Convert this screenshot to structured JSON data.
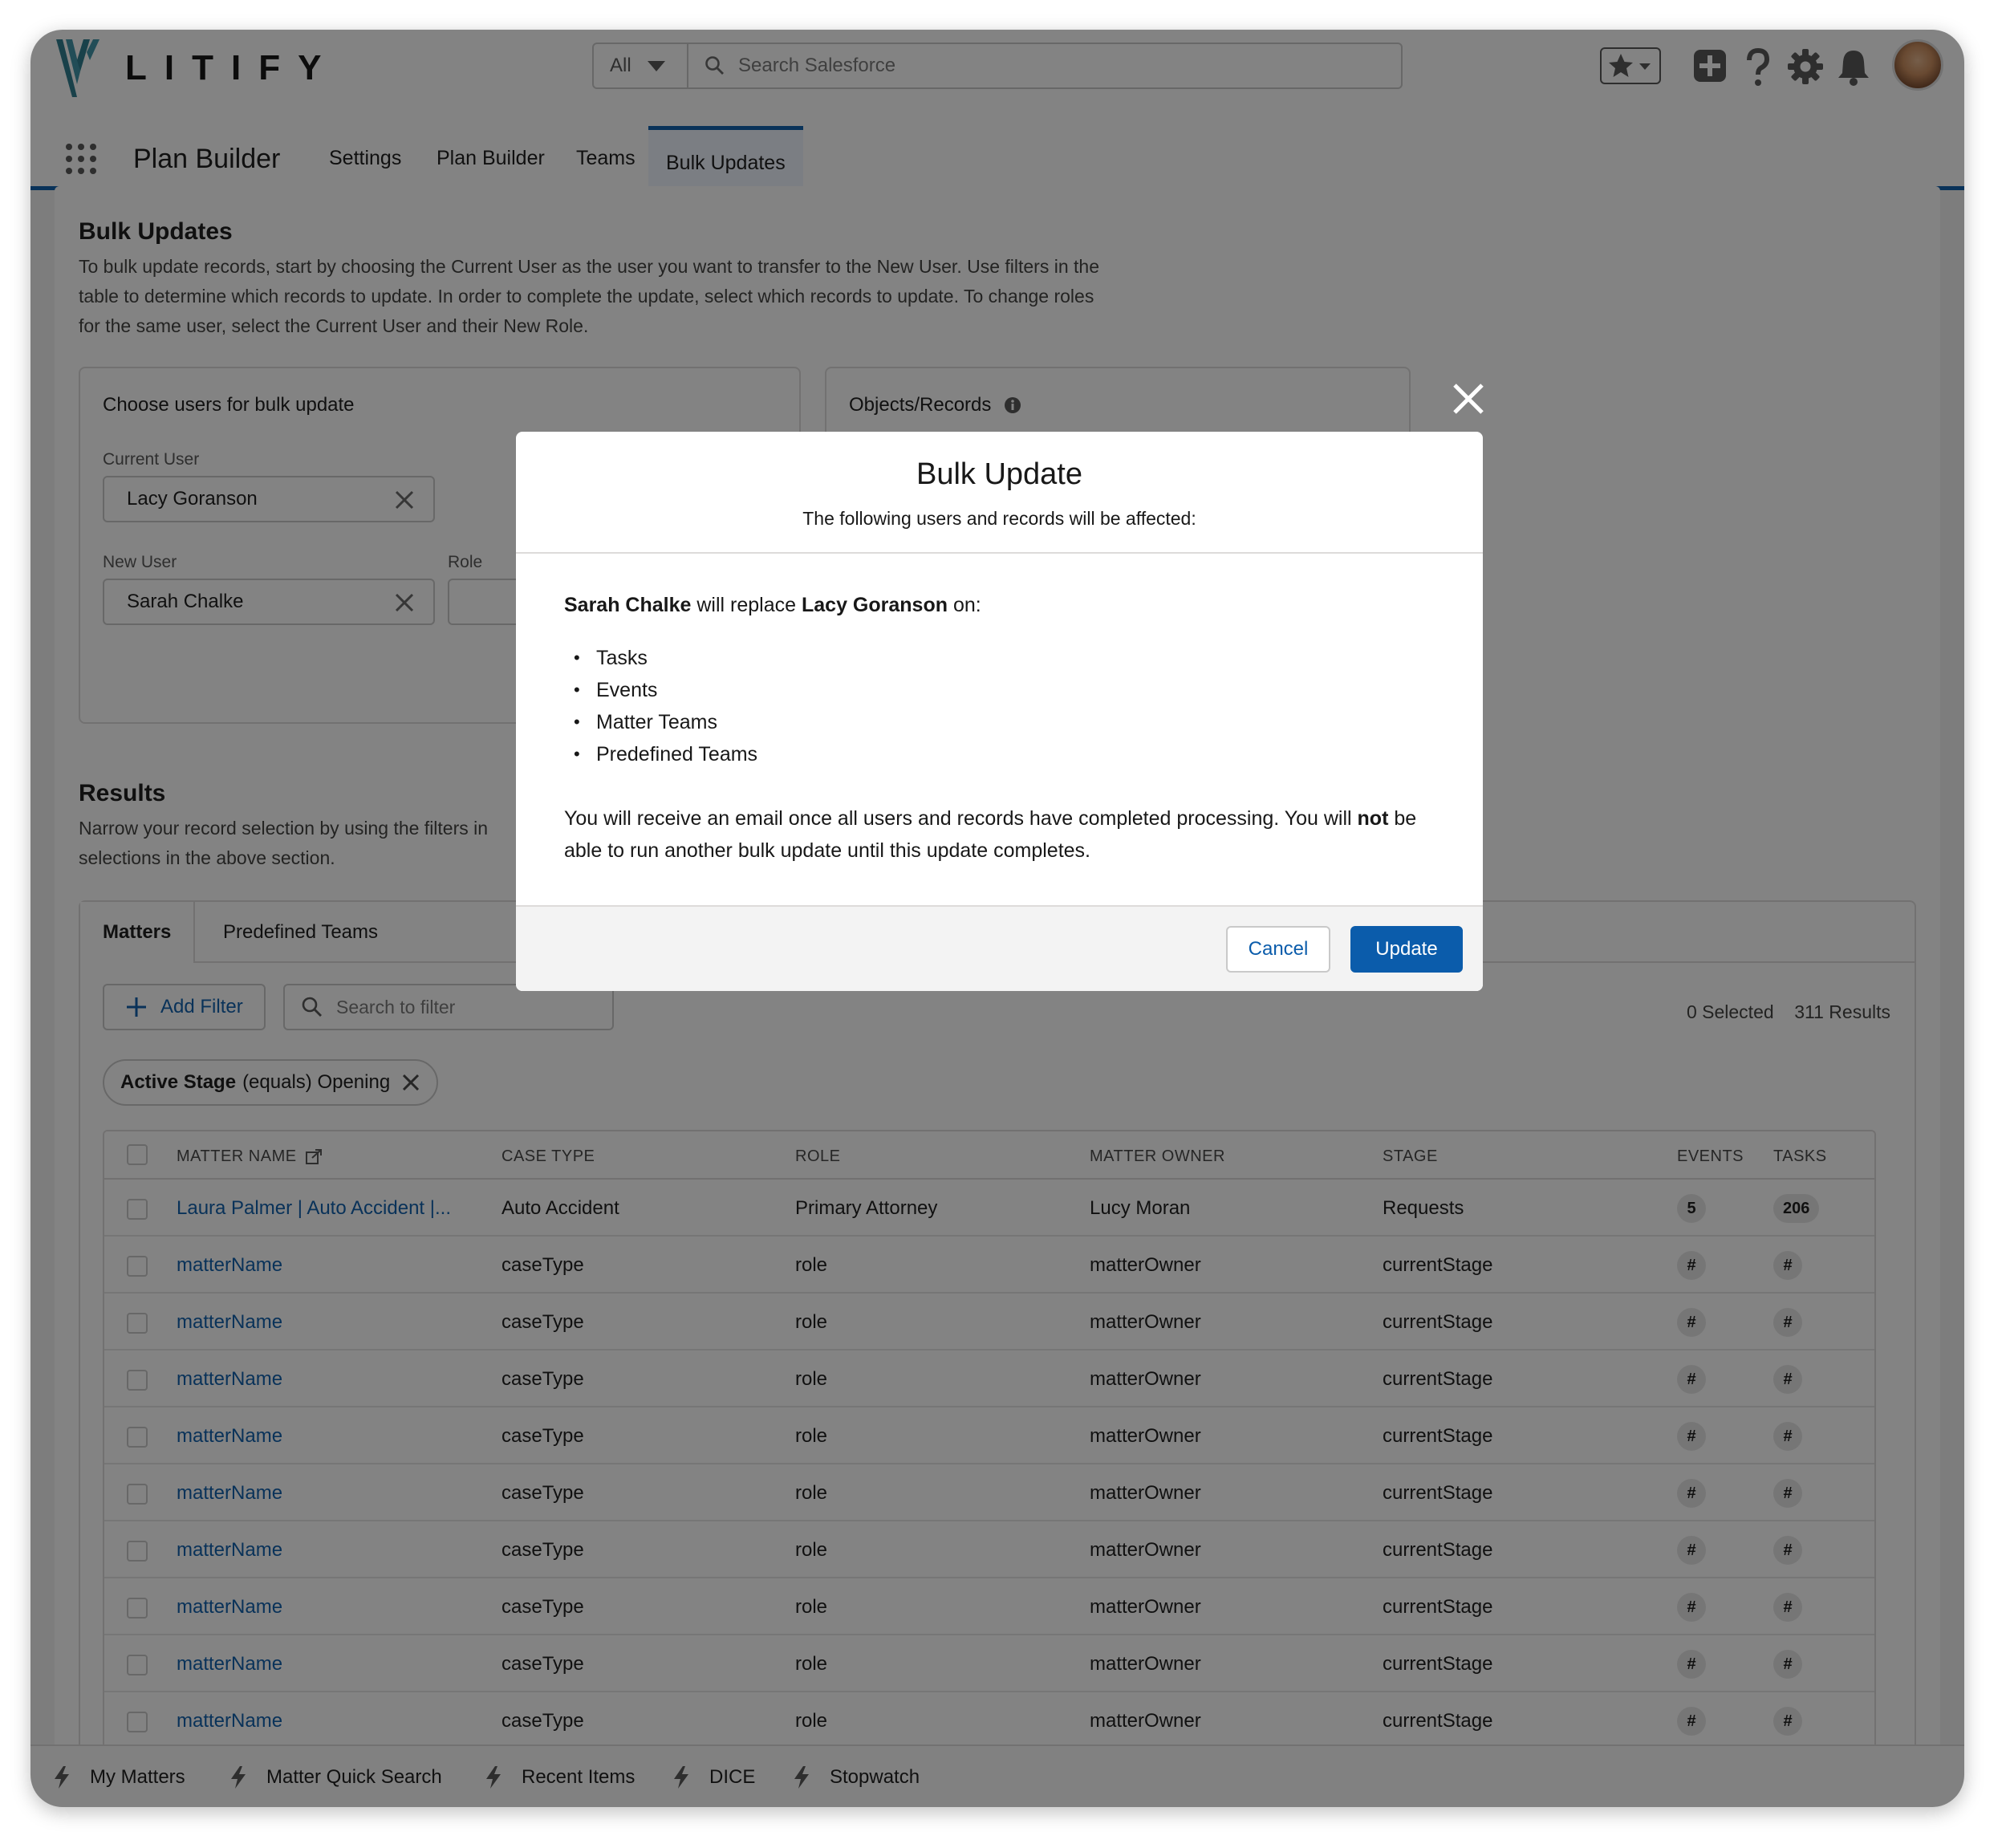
{
  "header": {
    "logo_text": "LITIFY",
    "search_scope": "All",
    "search_placeholder": "Search Salesforce"
  },
  "nav": {
    "app_name": "Plan Builder",
    "tabs": [
      {
        "label": "Settings"
      },
      {
        "label": "Plan Builder"
      },
      {
        "label": "Teams"
      },
      {
        "label": "Bulk Updates"
      }
    ]
  },
  "bulk_updates": {
    "title": "Bulk Updates",
    "description": "To bulk update records, start by choosing the Current User as the user you want to transfer to the New User. Use filters in the table to determine which records to update. In order to complete the update, select which records to update. To change roles for the same user, select the Current User and their New Role."
  },
  "choose_users": {
    "title": "Choose users for bulk update",
    "current_user_label": "Current User",
    "current_user_value": "Lacy Goranson",
    "new_user_label": "New User",
    "new_user_value": "Sarah Chalke",
    "role_label": "Role"
  },
  "objects_panel": {
    "title": "Objects/Records"
  },
  "results": {
    "title": "Results",
    "description_visible_1": "Narrow your record selection by using the filters in",
    "description_visible_2": "selections in the above section.",
    "tabs": [
      {
        "label": "Matters"
      },
      {
        "label": "Predefined Teams"
      }
    ],
    "add_filter_label": "Add Filter",
    "search_placeholder": "Search to filter",
    "selected_count": "0 Selected",
    "results_count": "311 Results",
    "filter_chip": {
      "field": "Active Stage",
      "operator_value": "(equals) Opening"
    }
  },
  "table": {
    "columns": [
      "MATTER NAME",
      "CASE TYPE",
      "ROLE",
      "MATTER OWNER",
      "STAGE",
      "EVENTS",
      "TASKS"
    ],
    "rows": [
      {
        "matter": "Laura Palmer | Auto Accident |...",
        "case_type": "Auto Accident",
        "role": "Primary Attorney",
        "owner": "Lucy Moran",
        "stage": "Requests",
        "events": "5",
        "tasks": "206"
      },
      {
        "matter": "matterName",
        "case_type": "caseType",
        "role": "role",
        "owner": "matterOwner",
        "stage": "currentStage",
        "events": "#",
        "tasks": "#"
      },
      {
        "matter": "matterName",
        "case_type": "caseType",
        "role": "role",
        "owner": "matterOwner",
        "stage": "currentStage",
        "events": "#",
        "tasks": "#"
      },
      {
        "matter": "matterName",
        "case_type": "caseType",
        "role": "role",
        "owner": "matterOwner",
        "stage": "currentStage",
        "events": "#",
        "tasks": "#"
      },
      {
        "matter": "matterName",
        "case_type": "caseType",
        "role": "role",
        "owner": "matterOwner",
        "stage": "currentStage",
        "events": "#",
        "tasks": "#"
      },
      {
        "matter": "matterName",
        "case_type": "caseType",
        "role": "role",
        "owner": "matterOwner",
        "stage": "currentStage",
        "events": "#",
        "tasks": "#"
      },
      {
        "matter": "matterName",
        "case_type": "caseType",
        "role": "role",
        "owner": "matterOwner",
        "stage": "currentStage",
        "events": "#",
        "tasks": "#"
      },
      {
        "matter": "matterName",
        "case_type": "caseType",
        "role": "role",
        "owner": "matterOwner",
        "stage": "currentStage",
        "events": "#",
        "tasks": "#"
      },
      {
        "matter": "matterName",
        "case_type": "caseType",
        "role": "role",
        "owner": "matterOwner",
        "stage": "currentStage",
        "events": "#",
        "tasks": "#"
      },
      {
        "matter": "matterName",
        "case_type": "caseType",
        "role": "role",
        "owner": "matterOwner",
        "stage": "currentStage",
        "events": "#",
        "tasks": "#"
      }
    ]
  },
  "utility_bar": {
    "items": [
      {
        "label": "My Matters"
      },
      {
        "label": "Matter Quick Search"
      },
      {
        "label": "Recent Items"
      },
      {
        "label": "DICE"
      },
      {
        "label": "Stopwatch"
      }
    ]
  },
  "modal": {
    "title": "Bulk Update",
    "subtitle": "The following users and records will be affected:",
    "new_user": "Sarah Chalke",
    "replace_text": "will replace",
    "current_user": "Lacy Goranson",
    "on_text": "on:",
    "affected": [
      "Tasks",
      "Events",
      "Matter Teams",
      "Predefined Teams"
    ],
    "notice_part1": "You will receive an email once all users and records have completed processing. You will",
    "notice_emphasis": "not",
    "notice_part2": "be able to run another bulk update until this update completes.",
    "cancel_label": "Cancel",
    "update_label": "Update"
  },
  "colors": {
    "brand_blue": "#0b5cab",
    "logo_teal": "#2a7b8c",
    "backdrop": "rgba(8,8,8,0.5)"
  },
  "icons": [
    "logo-mark-icon",
    "search-icon",
    "caret-down-icon",
    "star-icon",
    "add-icon",
    "help-icon",
    "gear-icon",
    "bell-icon",
    "app-launcher-icon",
    "clear-icon",
    "info-icon",
    "plus-icon",
    "external-link-icon",
    "lightning-icon",
    "close-icon"
  ]
}
